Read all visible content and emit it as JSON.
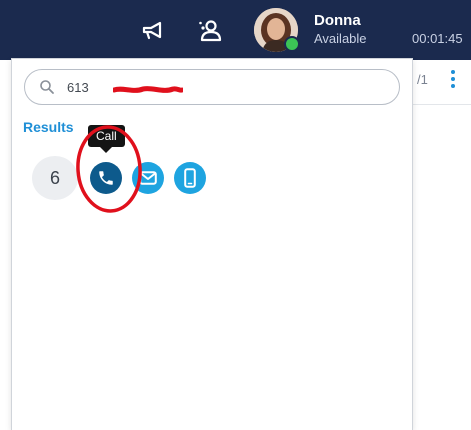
{
  "header": {
    "user": {
      "name": "Donna",
      "status": "Available"
    },
    "timer": "00:01:45",
    "icons": [
      "megaphone-icon",
      "contacts-icon"
    ]
  },
  "toolbar": {
    "pager": "/1",
    "more_icon": "vertical-ellipsis-icon"
  },
  "search": {
    "value": "613",
    "icon": "search-icon"
  },
  "results": {
    "title": "Results",
    "count": "6",
    "tooltip": "Call",
    "actions": [
      {
        "name": "call",
        "icon": "phone-icon"
      },
      {
        "name": "email",
        "icon": "envelope-icon"
      },
      {
        "name": "mobile",
        "icon": "mobile-phone-icon"
      }
    ]
  },
  "colors": {
    "topbar": "#1b2a4e",
    "accent": "#1f8fd6",
    "call_button": "#0d5a8c",
    "action_button": "#1ea4e0",
    "online": "#3cc456",
    "annotation": "#e0101c"
  }
}
